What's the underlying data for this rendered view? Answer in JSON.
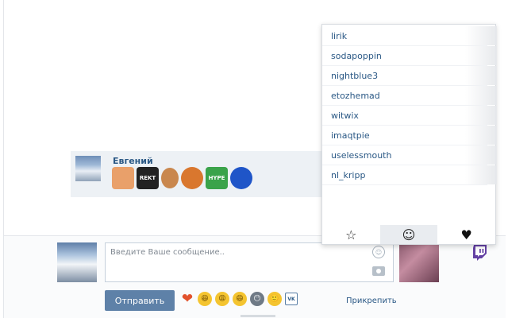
{
  "message": {
    "author": "Евгений",
    "emotes": [
      {
        "name": "cat-emote",
        "label": "",
        "cls": "em-cat"
      },
      {
        "name": "rekt-emote",
        "label": "REKT",
        "cls": "em-rekt"
      },
      {
        "name": "face-emote",
        "label": "",
        "cls": "em-face"
      },
      {
        "name": "fox-emote",
        "label": "",
        "cls": "em-fox"
      },
      {
        "name": "hype-emote",
        "label": "HYPE",
        "cls": "em-hype"
      },
      {
        "name": "sonic-emote",
        "label": "",
        "cls": "em-sonic"
      }
    ]
  },
  "popup": {
    "channels": [
      "lirik",
      "sodapoppin",
      "nightblue3",
      "etozhemad",
      "witwix",
      "imaqtpie",
      "uselessmouth",
      "nl_kripp"
    ],
    "tabs": [
      {
        "name": "tab-favorites",
        "icon": "☆",
        "selected": false
      },
      {
        "name": "tab-emotes",
        "icon": "☺",
        "selected": true
      },
      {
        "name": "tab-hearts",
        "icon": "♥",
        "selected": false
      }
    ]
  },
  "composer": {
    "placeholder": "Введите Ваше сообщение..",
    "send_label": "Отправить",
    "attach_label": "Прикрепить",
    "quick_emojis": [
      "❤",
      "😆",
      "😩",
      "😄",
      "😶",
      "🙂",
      "VK"
    ]
  },
  "colors": {
    "accent": "#2a5885",
    "send_button": "#5e81a8",
    "twitch": "#6441a4"
  }
}
